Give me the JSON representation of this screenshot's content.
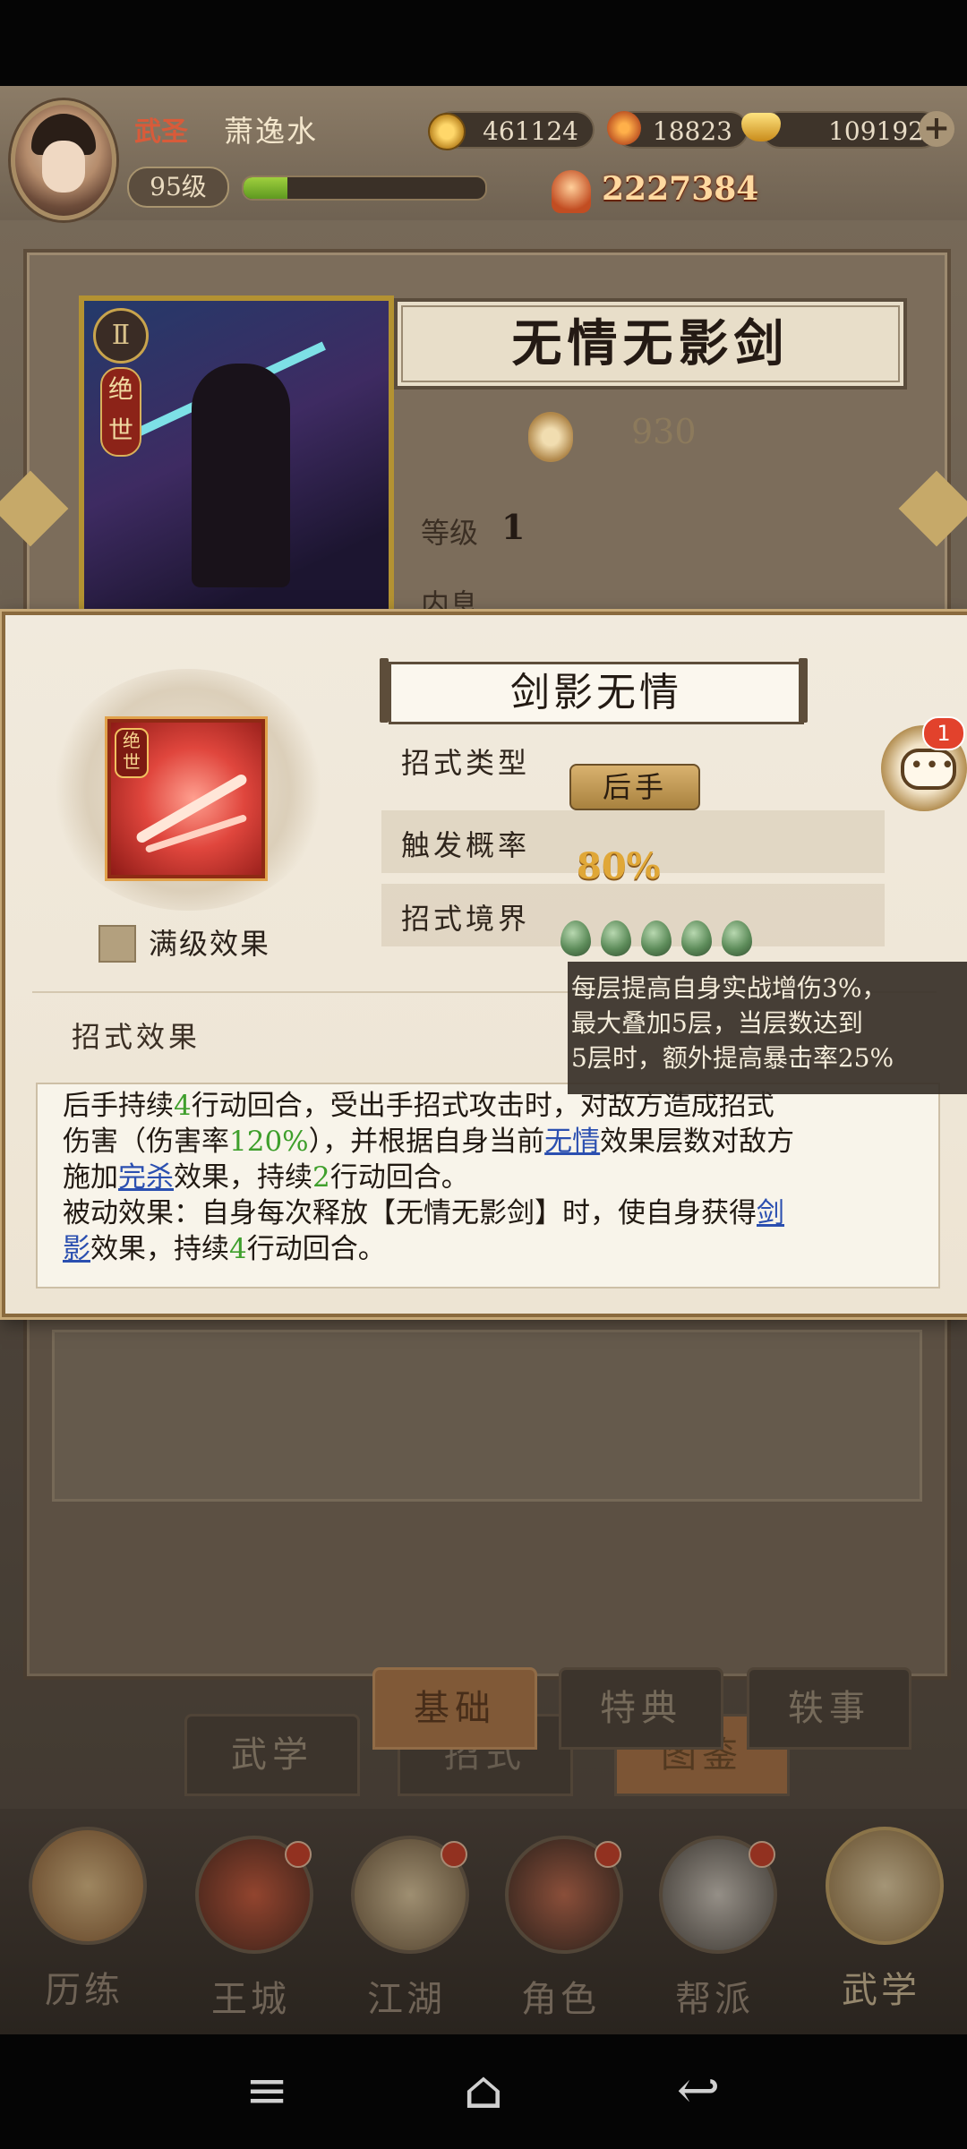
{
  "player": {
    "title": "武圣",
    "name": "萧逸水",
    "level": "95级",
    "exp_progress": 0.18,
    "power": "2227384"
  },
  "currency": {
    "coins": "461124",
    "ingots": "18823",
    "gold": "109192",
    "plus_icon": "+"
  },
  "card": {
    "rarity": "绝世",
    "badge": "Ⅱ",
    "skill_name": "无情无影剑",
    "cost": "930",
    "level_label": "等级",
    "level_value": "1",
    "inner_label": "内息"
  },
  "popup": {
    "move_name": "剑影无情",
    "icon_badge": "绝世",
    "max_level_label": "满级效果",
    "type_label": "招式类型",
    "type_value": "后手",
    "rate_label": "触发概率",
    "rate_value": "80%",
    "realm_label": "招式境界",
    "realm_level": 5,
    "effect_heading": "招式效果"
  },
  "effect_text": {
    "l1a": "后手持续",
    "l1n": "4",
    "l1b": "行动回合，受出手招式攻击时，对敌方造成招式",
    "l2a": "伤害（伤害率",
    "l2n": "120%",
    "l2b": "），并根据自身当前",
    "l2link": "无情",
    "l2c": "效果层数对敌方",
    "l3a": "施加",
    "l3link": "完杀",
    "l3b": "效果，持续",
    "l3n": "2",
    "l3c": "行动回合。",
    "l4a": "被动效果：自身每次释放【无情无影剑】时，使自身获得",
    "l4link": "剑",
    "l5link": "影",
    "l5a": "效果，持续",
    "l5n": "4",
    "l5b": "行动回合。"
  },
  "tooltip": {
    "line1": "每层提高自身实战增伤3%，",
    "line2": "最大叠加5层，当层数达到",
    "line3": "5层时，额外提高暴击率25%"
  },
  "chat": {
    "badge": "1",
    "icon": "chat-bubble-icon"
  },
  "tabs": {
    "basic": "基础",
    "classic": "特典",
    "story": "轶事",
    "wuxue": "武学",
    "moves": "招式",
    "atlas": "图鉴"
  },
  "nav": {
    "lilian": "历练",
    "wangcheng": "王城",
    "jianghu": "江湖",
    "juese": "角色",
    "bangpai": "帮派",
    "wuxue": "武学"
  },
  "system_nav": {
    "menu": "≡",
    "home": "⌂",
    "back": "↩"
  },
  "colors": {
    "accent_gold": "#e0a737",
    "link_blue": "#2b4fb0",
    "number_green": "#3f9f2c",
    "badge_red": "#e2422c"
  }
}
